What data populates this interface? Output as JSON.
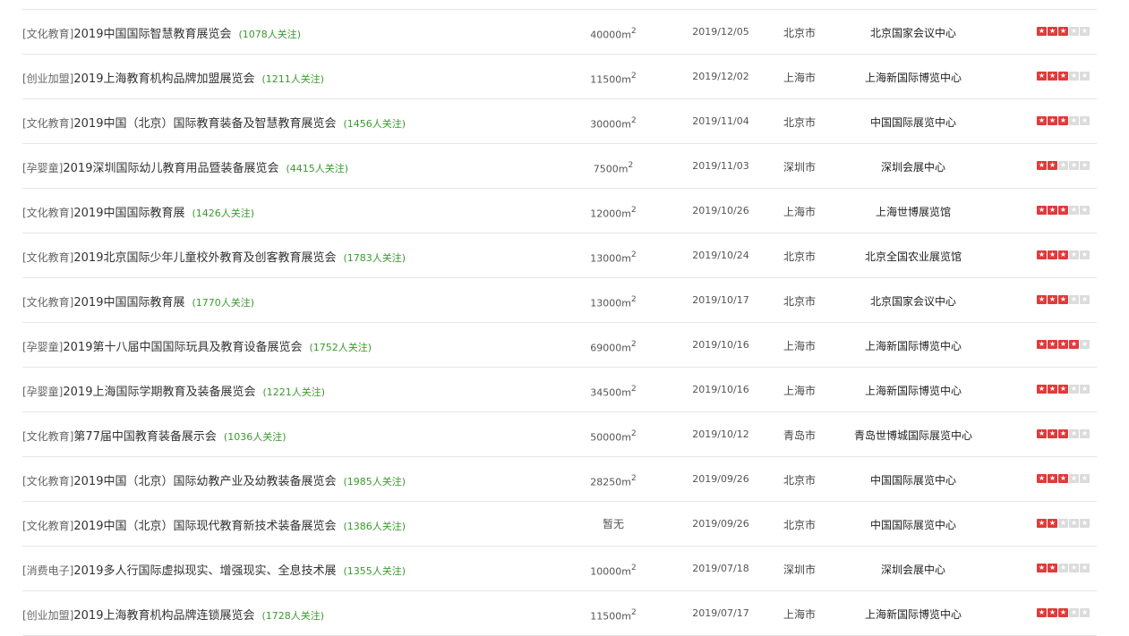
{
  "exhibitions": [
    {
      "category": "[文化教育]",
      "title": "2019中国国际智慧教育展览会",
      "followers": "(1078人关注)",
      "area_value": "40000m",
      "area_unit": "2",
      "date": "2019/12/05",
      "city": "北京市",
      "venue": "北京国家会议中心",
      "rating": 3
    },
    {
      "category": "[创业加盟]",
      "title": "2019上海教育机构品牌加盟展览会",
      "followers": "(1211人关注)",
      "area_value": "11500m",
      "area_unit": "2",
      "date": "2019/12/02",
      "city": "上海市",
      "venue": "上海新国际博览中心",
      "rating": 3
    },
    {
      "category": "[文化教育]",
      "title": "2019中国（北京）国际教育装备及智慧教育展览会",
      "followers": "(1456人关注)",
      "area_value": "30000m",
      "area_unit": "2",
      "date": "2019/11/04",
      "city": "北京市",
      "venue": "中国国际展览中心",
      "rating": 3
    },
    {
      "category": "[孕婴童]",
      "title": "2019深圳国际幼儿教育用品暨装备展览会",
      "followers": "(4415人关注)",
      "area_value": "7500m",
      "area_unit": "2",
      "date": "2019/11/03",
      "city": "深圳市",
      "venue": "深圳会展中心",
      "rating": 2
    },
    {
      "category": "[文化教育]",
      "title": "2019中国国际教育展",
      "followers": "(1426人关注)",
      "area_value": "12000m",
      "area_unit": "2",
      "date": "2019/10/26",
      "city": "上海市",
      "venue": "上海世博展览馆",
      "rating": 3
    },
    {
      "category": "[文化教育]",
      "title": "2019北京国际少年儿童校外教育及创客教育展览会",
      "followers": "(1783人关注)",
      "area_value": "13000m",
      "area_unit": "2",
      "date": "2019/10/24",
      "city": "北京市",
      "venue": "北京全国农业展览馆",
      "rating": 3
    },
    {
      "category": "[文化教育]",
      "title": "2019中国国际教育展",
      "followers": "(1770人关注)",
      "area_value": "13000m",
      "area_unit": "2",
      "date": "2019/10/17",
      "city": "北京市",
      "venue": "北京国家会议中心",
      "rating": 3
    },
    {
      "category": "[孕婴童]",
      "title": "2019第十八届中国国际玩具及教育设备展览会",
      "followers": "(1752人关注)",
      "area_value": "69000m",
      "area_unit": "2",
      "date": "2019/10/16",
      "city": "上海市",
      "venue": "上海新国际博览中心",
      "rating": 4
    },
    {
      "category": "[孕婴童]",
      "title": "2019上海国际学期教育及装备展览会",
      "followers": "(1221人关注)",
      "area_value": "34500m",
      "area_unit": "2",
      "date": "2019/10/16",
      "city": "上海市",
      "venue": "上海新国际博览中心",
      "rating": 3
    },
    {
      "category": "[文化教育]",
      "title": "第77届中国教育装备展示会",
      "followers": "(1036人关注)",
      "area_value": "50000m",
      "area_unit": "2",
      "date": "2019/10/12",
      "city": "青岛市",
      "venue": "青岛世博城国际展览中心",
      "rating": 3
    },
    {
      "category": "[文化教育]",
      "title": "2019中国（北京）国际幼教产业及幼教装备展览会",
      "followers": "(1985人关注)",
      "area_value": "28250m",
      "area_unit": "2",
      "date": "2019/09/26",
      "city": "北京市",
      "venue": "中国国际展览中心",
      "rating": 3
    },
    {
      "category": "[文化教育]",
      "title": "2019中国（北京）国际现代教育新技术装备展览会",
      "followers": "(1386人关注)",
      "area_value": "暂无",
      "area_unit": "",
      "date": "2019/09/26",
      "city": "北京市",
      "venue": "中国国际展览中心",
      "rating": 2
    },
    {
      "category": "[消费电子]",
      "title": "2019多人行国际虚拟现实、增强现实、全息技术展",
      "followers": "(1355人关注)",
      "area_value": "10000m",
      "area_unit": "2",
      "date": "2019/07/18",
      "city": "深圳市",
      "venue": "深圳会展中心",
      "rating": 2
    },
    {
      "category": "[创业加盟]",
      "title": "2019上海教育机构品牌连锁展览会",
      "followers": "(1728人关注)",
      "area_value": "11500m",
      "area_unit": "2",
      "date": "2019/07/17",
      "city": "上海市",
      "venue": "上海新国际博览中心",
      "rating": 3
    }
  ],
  "rating_max": 5,
  "colors": {
    "star_on": "#e03a3a",
    "star_off": "#dcdcdc",
    "followers": "#3a9a2e"
  }
}
